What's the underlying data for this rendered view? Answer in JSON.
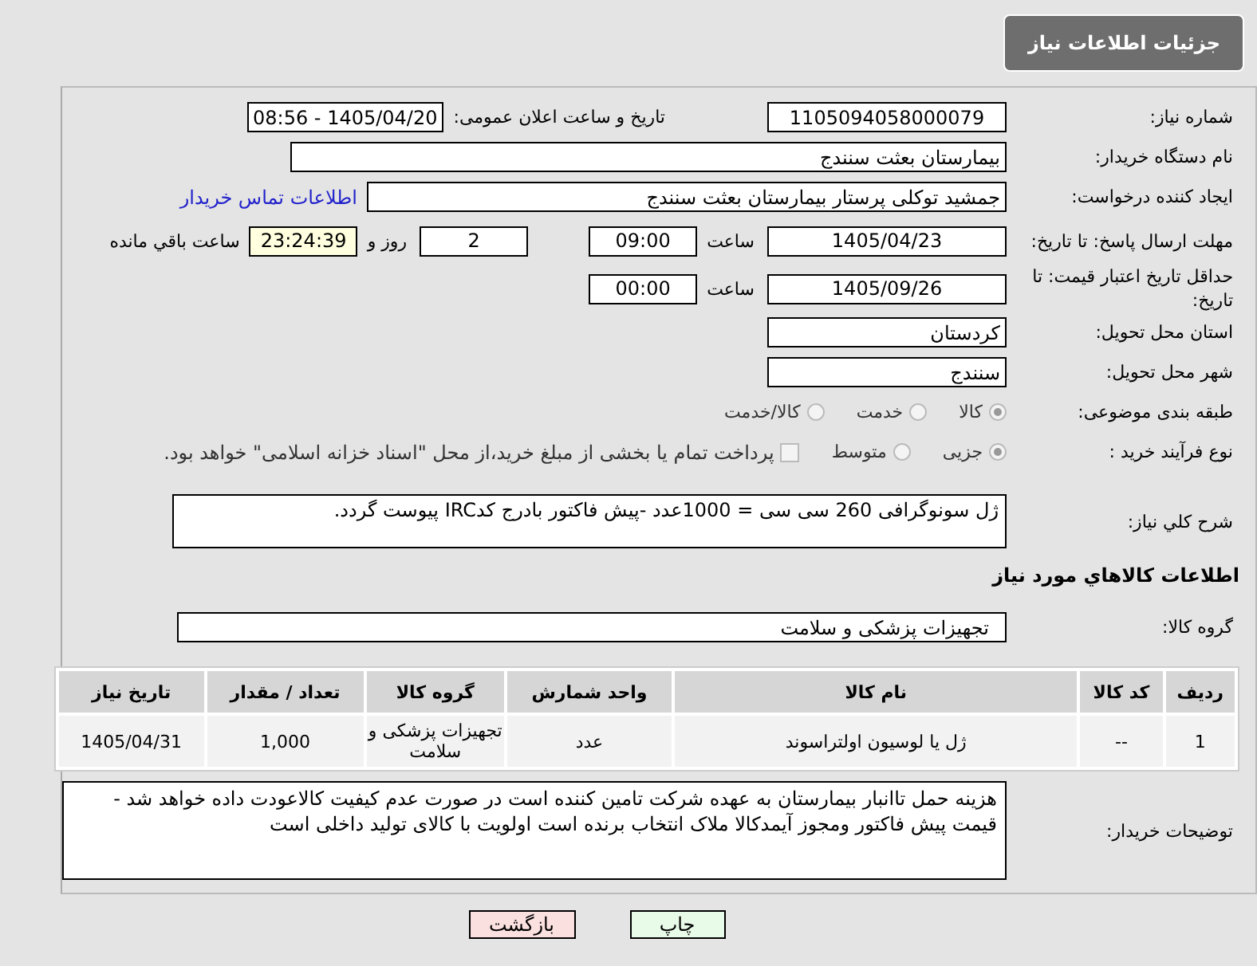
{
  "header": {
    "title": "جزئیات اطلاعات نیاز"
  },
  "need_number": {
    "label": "شماره نیاز:",
    "value": "1105094058000079"
  },
  "announce": {
    "label": "تاریخ و ساعت اعلان عمومی:",
    "value": "1405/04/20 - 08:56"
  },
  "buyer": {
    "label": "نام دستگاه خریدار:",
    "value": "بیمارستان بعثت سنندج"
  },
  "creator": {
    "label": "ایجاد کننده درخواست:",
    "value": "جمشید  توکلی پرستار بیمارستان بعثت سنندج",
    "link": "اطلاعات تماس خریدار"
  },
  "deadline": {
    "label": "مهلت ارسال پاسخ: تا تاریخ:",
    "date": "1405/04/23",
    "time_label": "ساعت",
    "time": "09:00",
    "days": "2",
    "days_label": "روز و",
    "remaining": "23:24:39",
    "remaining_label": "ساعت باقي مانده"
  },
  "validity": {
    "label": "حداقل تاریخ اعتبار قیمت: تا تاریخ:",
    "date": "1405/09/26",
    "time_label": "ساعت",
    "time": "00:00"
  },
  "province": {
    "label": "استان محل تحویل:",
    "value": "کردستان"
  },
  "city": {
    "label": "شهر محل تحویل:",
    "value": "سنندج"
  },
  "category": {
    "label": "طبقه بندی موضوعی:",
    "options": [
      {
        "label": "کالا",
        "selected": true
      },
      {
        "label": "خدمت",
        "selected": false
      },
      {
        "label": "کالا/خدمت",
        "selected": false
      }
    ]
  },
  "process": {
    "label": "نوع فرآیند خرید :",
    "options": [
      {
        "label": "جزیی",
        "selected": true
      },
      {
        "label": "متوسط",
        "selected": false
      }
    ],
    "payment": {
      "label": "پرداخت تمام یا بخشی از مبلغ خرید،از محل \"اسناد خزانه اسلامی\" خواهد بود.",
      "checked": false
    }
  },
  "description": {
    "label": "شرح کلي نیاز:",
    "value": "ژل سونوگرافی 260 سی سی = 1000عدد -پیش فاکتور بادرج کدIRC پیوست گردد."
  },
  "items_title": "اطلاعات کالاهاي مورد نیاز",
  "goods_group": {
    "label": "گروه کالا:",
    "value": "تجهیزات پزشکی و سلامت"
  },
  "table": {
    "columns": [
      "ردیف",
      "کد کالا",
      "نام کالا",
      "واحد شمارش",
      "گروه کالا",
      "تعداد / مقدار",
      "تاریخ نیاز"
    ],
    "rows": [
      [
        "1",
        "--",
        "ژل یا لوسیون اولتراسوند",
        "عدد",
        "تجهیزات پزشکی و سلامت",
        "1,000",
        "1405/04/31"
      ]
    ]
  },
  "buyer_notes": {
    "label": "توضیحات خریدار:",
    "value": "هزینه حمل تاانبار بیمارستان به عهده شرکت تامین کننده است در صورت عدم کیفیت کالاعودت داده خواهد شد - قیمت پیش فاکتور ومجوز آیمدکالا ملاک انتخاب برنده است اولویت با کالای تولید داخلی است"
  },
  "buttons": [
    {
      "label": "چاپ",
      "kind": "print"
    },
    {
      "label": "بازگشت",
      "kind": "back"
    }
  ]
}
